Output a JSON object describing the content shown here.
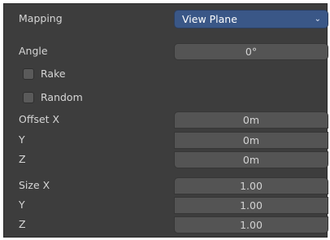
{
  "mapping": {
    "label": "Mapping",
    "value": "View Plane",
    "chevron": "⌄"
  },
  "angle": {
    "label": "Angle",
    "value": "0°"
  },
  "options": [
    {
      "label": "Rake",
      "checked": false
    },
    {
      "label": "Random",
      "checked": false
    }
  ],
  "offset": {
    "labels": {
      "x": "Offset X",
      "y": "Y",
      "z": "Z"
    },
    "values": {
      "x": "0m",
      "y": "0m",
      "z": "0m"
    }
  },
  "size": {
    "labels": {
      "x": "Size X",
      "y": "Y",
      "z": "Z"
    },
    "values": {
      "x": "1.00",
      "y": "1.00",
      "z": "1.00"
    }
  },
  "colors": {
    "panel_bg": "#3d3d3d",
    "field_bg": "#545454",
    "dropdown_bg": "#3a5787",
    "text": "#d6d6d6"
  }
}
